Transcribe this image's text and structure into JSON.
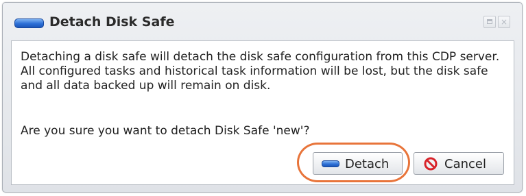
{
  "dialog": {
    "title": "Detach Disk Safe",
    "title_icon": "disk-safe-icon",
    "window_buttons": [
      {
        "name": "maximize-icon",
        "glyph": ""
      },
      {
        "name": "close-icon",
        "glyph": "×"
      }
    ]
  },
  "content": {
    "message": "Detaching a disk safe will detach the disk safe configuration from this CDP server. All configured tasks and historical task information will be lost, but the disk safe and all data backed up will remain on disk.",
    "question": "Are you sure you want to detach Disk Safe 'new'?"
  },
  "buttons": {
    "detach_label": "Detach",
    "detach_icon": "disk-safe-icon",
    "cancel_label": "Cancel",
    "cancel_icon": "no-entry-icon"
  },
  "colors": {
    "accent_blue": "#2c6fd6",
    "highlight_orange": "#e8743a",
    "cancel_red": "#d8232a"
  }
}
